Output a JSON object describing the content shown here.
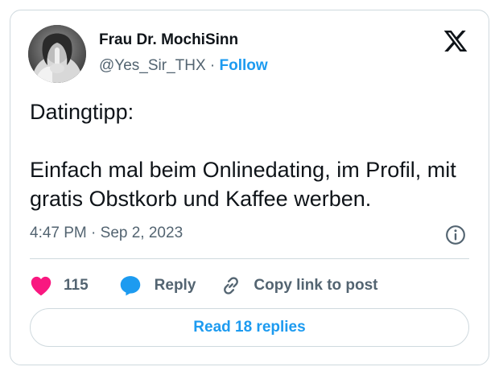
{
  "author": {
    "name": "Frau Dr. MochiSinn",
    "handle": "@Yes_Sir_THX",
    "separator": "·",
    "follow_label": "Follow"
  },
  "tweet": {
    "paragraphs": [
      "Datingtipp:",
      "Einfach mal beim Onlinedating, im Profil, mit gratis Obstkorb und Kaffee werben."
    ],
    "time": "4:47 PM",
    "date_separator": "·",
    "date": "Sep 2, 2023"
  },
  "actions": {
    "like_count": "115",
    "reply_label": "Reply",
    "copy_label": "Copy link to post"
  },
  "read_replies_label": "Read 18 replies",
  "icons": {
    "logo": "x-logo-icon",
    "info": "info-icon",
    "like": "heart-icon",
    "reply": "speech-bubble-icon",
    "copy": "link-icon"
  },
  "colors": {
    "accent": "#1d9bf0",
    "like": "#f91880",
    "secondary_text": "#536471",
    "border": "#cfd9de",
    "primary_text": "#0f1419"
  }
}
